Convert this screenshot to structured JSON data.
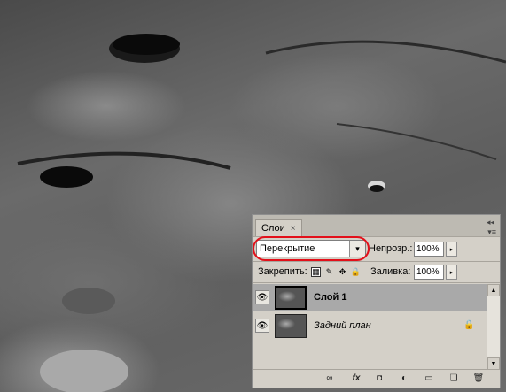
{
  "panel": {
    "tab_title": "Слои",
    "tab_close": "×",
    "collapse_glyph": "◂◂",
    "menu_glyph": "▾≡",
    "blend_mode": "Перекрытие",
    "blend_arrow": "▾",
    "opacity_label": "Непрозр.:",
    "opacity_value": "100%",
    "opacity_arrow": "▸",
    "lock_label": "Закрепить:",
    "lock_icons": [
      "▦",
      "✎",
      "✥",
      "🔒"
    ],
    "fill_label": "Заливка:",
    "fill_value": "100%",
    "fill_arrow": "▸",
    "highlight_color": "#e3101a"
  },
  "layers": [
    {
      "name": "Слой 1",
      "visible_glyph": "👁",
      "selected": true
    },
    {
      "name": "Задний план",
      "visible_glyph": "👁",
      "locked_glyph": "🔒",
      "selected": false
    }
  ],
  "scrollbar": {
    "up": "▲",
    "down": "▼"
  },
  "bottom_icons": [
    {
      "glyph": "∞",
      "label": "link-layers-icon"
    },
    {
      "glyph": "fx",
      "label": "layer-style-icon"
    },
    {
      "glyph": "◘",
      "label": "add-mask-icon"
    },
    {
      "glyph": "◐",
      "label": "adjustment-layer-icon"
    },
    {
      "glyph": "▭",
      "label": "new-group-icon"
    },
    {
      "glyph": "❏",
      "label": "new-layer-icon"
    },
    {
      "glyph": "🗑",
      "label": "delete-layer-icon"
    }
  ]
}
